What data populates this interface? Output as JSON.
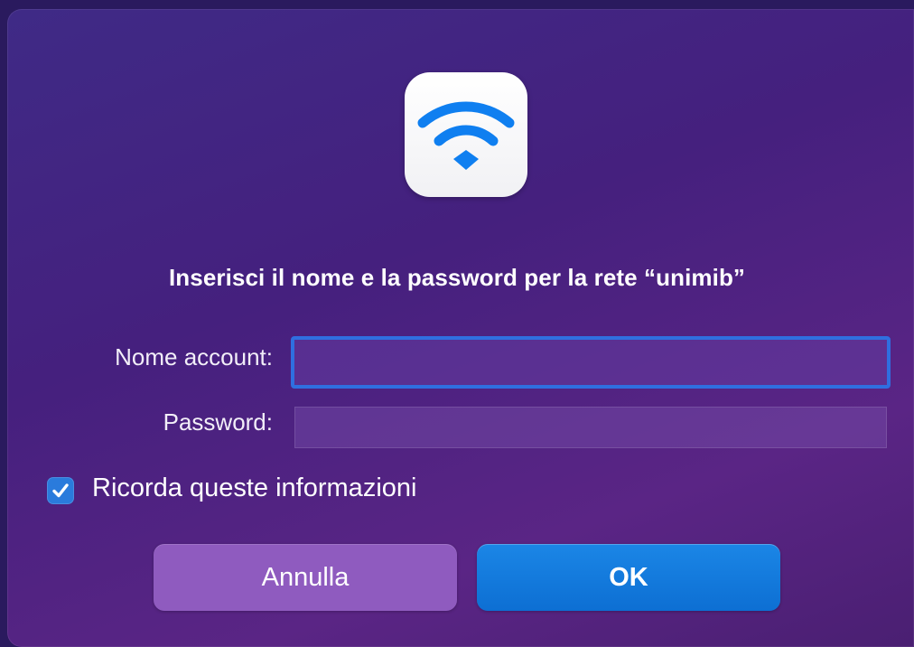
{
  "dialog": {
    "icon": "wifi-icon",
    "title": "Inserisci il nome e la password per la rete “unimib”",
    "account_label": "Nome account:",
    "account_value": "",
    "password_label": "Password:",
    "password_value": "",
    "remember_label": "Ricorda queste informazioni",
    "remember_checked": true,
    "cancel_label": "Annulla",
    "ok_label": "OK"
  },
  "colors": {
    "accent": "#0d6fd3",
    "focus_ring": "#2f6fe0",
    "wifi_blue": "#0f7ff0",
    "cancel_button": "#8f5bbf"
  }
}
